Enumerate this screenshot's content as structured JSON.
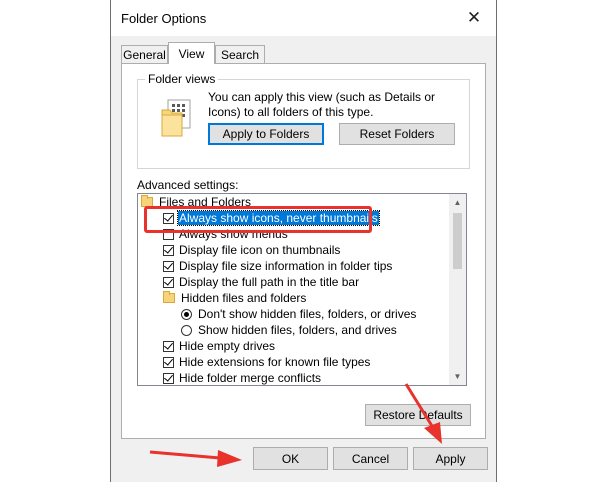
{
  "window": {
    "title": "Folder Options",
    "close_glyph": "✕"
  },
  "tabs": [
    {
      "label": "General"
    },
    {
      "label": "View",
      "active": true
    },
    {
      "label": "Search"
    }
  ],
  "folder_views": {
    "group_label": "Folder views",
    "description": "You can apply this view (such as Details or Icons) to all folders of this type.",
    "apply_button": "Apply to Folders",
    "reset_button": "Reset Folders"
  },
  "advanced": {
    "label": "Advanced settings:",
    "items": [
      {
        "type": "folder",
        "label": "Files and Folders",
        "indent": 0
      },
      {
        "type": "checkbox",
        "label": "Always show icons, never thumbnails",
        "checked": true,
        "selected": true,
        "indent": 1
      },
      {
        "type": "checkbox",
        "label": "Always show menus",
        "checked": false,
        "indent": 1
      },
      {
        "type": "checkbox",
        "label": "Display file icon on thumbnails",
        "checked": true,
        "indent": 1
      },
      {
        "type": "checkbox",
        "label": "Display file size information in folder tips",
        "checked": true,
        "indent": 1
      },
      {
        "type": "checkbox",
        "label": "Display the full path in the title bar",
        "checked": true,
        "indent": 1
      },
      {
        "type": "folder",
        "label": "Hidden files and folders",
        "indent": 1
      },
      {
        "type": "radio",
        "label": "Don't show hidden files, folders, or drives",
        "checked": true,
        "indent": 2
      },
      {
        "type": "radio",
        "label": "Show hidden files, folders, and drives",
        "checked": false,
        "indent": 2
      },
      {
        "type": "checkbox",
        "label": "Hide empty drives",
        "checked": true,
        "indent": 1
      },
      {
        "type": "checkbox",
        "label": "Hide extensions for known file types",
        "checked": true,
        "indent": 1
      },
      {
        "type": "checkbox",
        "label": "Hide folder merge conflicts",
        "checked": true,
        "indent": 1
      }
    ],
    "restore_button": "Restore Defaults"
  },
  "footer": {
    "ok": "OK",
    "cancel": "Cancel",
    "apply": "Apply"
  },
  "colors": {
    "accent": "#0078d7",
    "annotation_red": "#e8322b"
  }
}
